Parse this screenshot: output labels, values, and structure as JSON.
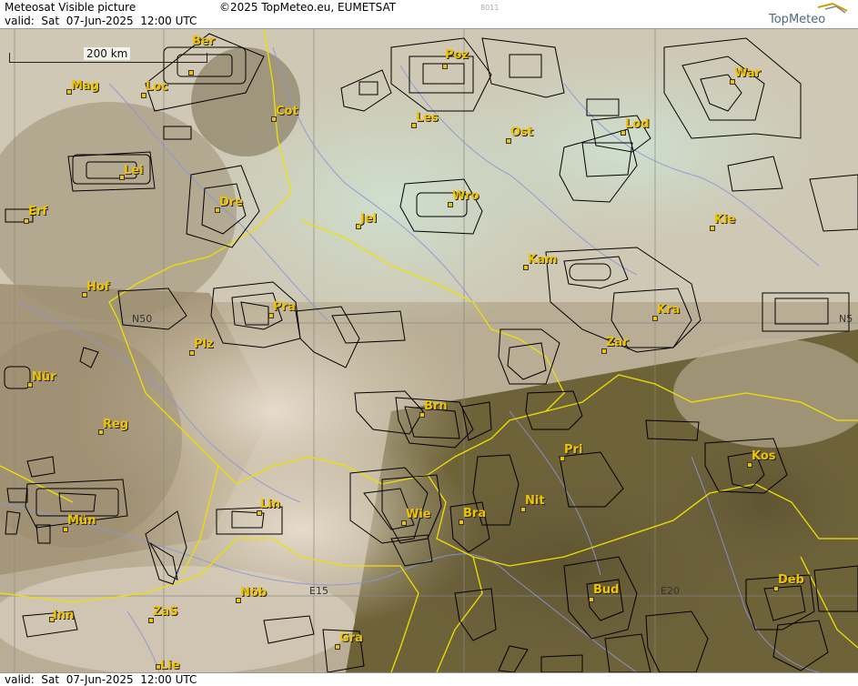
{
  "header": {
    "title": "Meteosat Visible picture",
    "copyright": "©2025 TopMeteo.eu, EUMETSAT",
    "valid": "valid:  Sat  07-Jun-2025  12:00 UTC",
    "code": "8011",
    "logo_text": "TopMeteo"
  },
  "footer": {
    "valid": "valid:  Sat  07-Jun-2025  12:00 UTC"
  },
  "scale": {
    "label": "200 km"
  },
  "grid_labels": {
    "n50_left": "N50",
    "n50_right": "N5",
    "e15": "E15",
    "e20": "E20"
  },
  "cities": [
    {
      "key": "ber",
      "name": "Ber"
    },
    {
      "key": "mag",
      "name": "Mag"
    },
    {
      "key": "loc",
      "name": "Loc"
    },
    {
      "key": "cot",
      "name": "Cot"
    },
    {
      "key": "poz",
      "name": "Poz"
    },
    {
      "key": "war",
      "name": "War"
    },
    {
      "key": "les",
      "name": "Les"
    },
    {
      "key": "ost",
      "name": "Ost"
    },
    {
      "key": "lod",
      "name": "Lod"
    },
    {
      "key": "lei",
      "name": "Lei"
    },
    {
      "key": "dre",
      "name": "Dre"
    },
    {
      "key": "wro",
      "name": "Wro"
    },
    {
      "key": "erf",
      "name": "Erf"
    },
    {
      "key": "jel",
      "name": "Jel"
    },
    {
      "key": "kie",
      "name": "Kie"
    },
    {
      "key": "kam",
      "name": "Kam"
    },
    {
      "key": "hof",
      "name": "Hof"
    },
    {
      "key": "pra",
      "name": "Pra"
    },
    {
      "key": "kra",
      "name": "Kra"
    },
    {
      "key": "plz",
      "name": "Plz"
    },
    {
      "key": "zar",
      "name": "Zar"
    },
    {
      "key": "nur",
      "name": "Nür"
    },
    {
      "key": "brn",
      "name": "Brn"
    },
    {
      "key": "reg",
      "name": "Reg"
    },
    {
      "key": "pri",
      "name": "Pri"
    },
    {
      "key": "kos",
      "name": "Kos"
    },
    {
      "key": "nit",
      "name": "Nit"
    },
    {
      "key": "lin",
      "name": "Lin"
    },
    {
      "key": "wie",
      "name": "Wie"
    },
    {
      "key": "bra",
      "name": "Bra"
    },
    {
      "key": "mun",
      "name": "Mün"
    },
    {
      "key": "bud",
      "name": "Bud"
    },
    {
      "key": "deb",
      "name": "Deb"
    },
    {
      "key": "nob",
      "name": "Nöb"
    },
    {
      "key": "inn",
      "name": "Inn"
    },
    {
      "key": "zas",
      "name": "ZaS"
    },
    {
      "key": "gra",
      "name": "Gra"
    },
    {
      "key": "lie",
      "name": "Lie"
    }
  ],
  "colors": {
    "border": "#f0e000",
    "river": "#8a95d8",
    "outline": "#000000",
    "label": "#f0c400"
  }
}
